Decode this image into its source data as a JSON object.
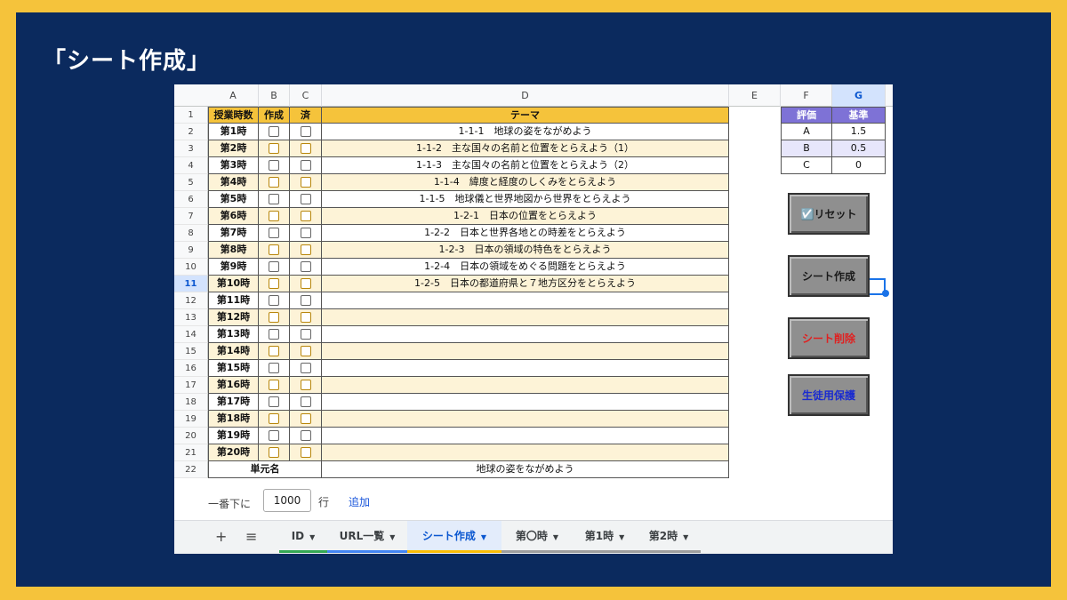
{
  "title": "「シート作成」",
  "columns": [
    "A",
    "B",
    "C",
    "D",
    "E",
    "F",
    "G"
  ],
  "header_row": {
    "a": "授業時数",
    "b": "作成",
    "c": "済",
    "d": "テーマ"
  },
  "row_numbers": [
    "1",
    "2",
    "3",
    "4",
    "5",
    "6",
    "7",
    "8",
    "9",
    "10",
    "11",
    "12",
    "13",
    "14",
    "15",
    "16",
    "17",
    "18",
    "19",
    "20",
    "21",
    "22"
  ],
  "rows": [
    {
      "period": "第1時",
      "theme": "1-1-1　地球の姿をながめよう"
    },
    {
      "period": "第2時",
      "theme": "1-1-2　主な国々の名前と位置をとらえよう（1）"
    },
    {
      "period": "第3時",
      "theme": "1-1-3　主な国々の名前と位置をとらえよう（2）"
    },
    {
      "period": "第4時",
      "theme": "1-1-4　緯度と経度のしくみをとらえよう"
    },
    {
      "period": "第5時",
      "theme": "1-1-5　地球儀と世界地図から世界をとらえよう"
    },
    {
      "period": "第6時",
      "theme": "1-2-1　日本の位置をとらえよう"
    },
    {
      "period": "第7時",
      "theme": "1-2-2　日本と世界各地との時差をとらえよう"
    },
    {
      "period": "第8時",
      "theme": "1-2-3　日本の領域の特色をとらえよう"
    },
    {
      "period": "第9時",
      "theme": "1-2-4　日本の領域をめぐる問題をとらえよう"
    },
    {
      "period": "第10時",
      "theme": "1-2-5　日本の都道府県と７地方区分をとらえよう"
    },
    {
      "period": "第11時",
      "theme": ""
    },
    {
      "period": "第12時",
      "theme": ""
    },
    {
      "period": "第13時",
      "theme": ""
    },
    {
      "period": "第14時",
      "theme": ""
    },
    {
      "period": "第15時",
      "theme": ""
    },
    {
      "period": "第16時",
      "theme": ""
    },
    {
      "period": "第17時",
      "theme": ""
    },
    {
      "period": "第18時",
      "theme": ""
    },
    {
      "period": "第19時",
      "theme": ""
    },
    {
      "period": "第20時",
      "theme": ""
    }
  ],
  "unit_row": {
    "label": "単元名",
    "value": "地球の姿をながめよう"
  },
  "eval_table": {
    "header": [
      "評価",
      "基準"
    ],
    "rows": [
      [
        "A",
        "1.5"
      ],
      [
        "B",
        "0.5"
      ],
      [
        "C",
        "0"
      ]
    ]
  },
  "buttons": {
    "reset": "☑️リセット",
    "create": "シート作成",
    "delete": "シート削除",
    "protect": "生徒用保護"
  },
  "add_rows": {
    "label": "一番下に",
    "count": "1000",
    "unit": "行",
    "add": "追加"
  },
  "tabs": [
    {
      "label": "ID",
      "color": "#34a853"
    },
    {
      "label": "URL一覧",
      "color": "#4285f4"
    },
    {
      "label": "シート作成",
      "color": "#fbbc04"
    },
    {
      "label": "第〇時",
      "color": "#9e9e9e"
    },
    {
      "label": "第1時",
      "color": "#9e9e9e"
    },
    {
      "label": "第2時",
      "color": "#9e9e9e"
    }
  ],
  "tab_controls": {
    "add": "+",
    "menu": "≡",
    "dropdown": "▼"
  },
  "colors": {
    "frame": "#0b2a5e",
    "border": "#f5c33b",
    "header_yellow": "#f5c33b",
    "eval_header": "#7e72d6",
    "delete_text": "#e02020",
    "protect_text": "#1a2bd0"
  }
}
